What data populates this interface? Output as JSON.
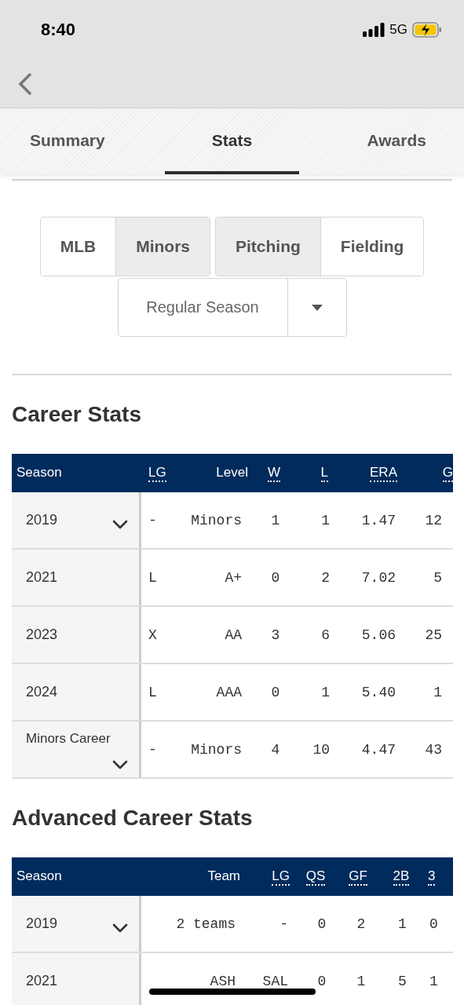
{
  "status_bar": {
    "time": "8:40",
    "network": "5G",
    "charging": true
  },
  "tabs": [
    {
      "label": "Summary",
      "selected": false
    },
    {
      "label": "Stats",
      "selected": true
    },
    {
      "label": "Awards",
      "selected": false
    }
  ],
  "segment_groups": [
    [
      {
        "label": "MLB",
        "selected": false
      },
      {
        "label": "Minors",
        "selected": true
      }
    ],
    [
      {
        "label": "Pitching",
        "selected": true
      },
      {
        "label": "Fielding",
        "selected": false
      }
    ]
  ],
  "season_type": {
    "value": "Regular Season"
  },
  "tables": [
    {
      "title": "Career Stats",
      "columns": [
        {
          "label": "Season",
          "abbr": false
        },
        {
          "label": "LG",
          "abbr": true
        },
        {
          "label": "Level",
          "abbr": false
        },
        {
          "label": "W",
          "abbr": true
        },
        {
          "label": "L",
          "abbr": true
        },
        {
          "label": "ERA",
          "abbr": true
        },
        {
          "label": "G",
          "abbr": true
        }
      ],
      "rows": [
        {
          "expandable": true,
          "cells": [
            "2019",
            "-",
            "Minors",
            "1",
            "1",
            "1.47",
            "12"
          ]
        },
        {
          "expandable": false,
          "cells": [
            "2021",
            "L",
            "A+",
            "0",
            "2",
            "7.02",
            "5"
          ]
        },
        {
          "expandable": false,
          "cells": [
            "2023",
            "X",
            "AA",
            "3",
            "6",
            "5.06",
            "25"
          ]
        },
        {
          "expandable": false,
          "cells": [
            "2024",
            "L",
            "AAA",
            "0",
            "1",
            "5.40",
            "1"
          ]
        },
        {
          "expandable": true,
          "cells": [
            "Minors Career",
            "-",
            "Minors",
            "4",
            "10",
            "4.47",
            "43"
          ]
        }
      ]
    },
    {
      "title": "Advanced Career Stats",
      "columns": [
        {
          "label": "Season",
          "abbr": false
        },
        {
          "label": "Team",
          "abbr": false
        },
        {
          "label": "LG",
          "abbr": true
        },
        {
          "label": "QS",
          "abbr": true
        },
        {
          "label": "GF",
          "abbr": true
        },
        {
          "label": "2B",
          "abbr": true
        },
        {
          "label": "3",
          "abbr": true
        }
      ],
      "rows": [
        {
          "expandable": true,
          "cells": [
            "2019",
            "2 teams",
            "-",
            "0",
            "2",
            "1",
            "0"
          ]
        },
        {
          "expandable": false,
          "cells": [
            "2021",
            "ASH",
            "SAL",
            "0",
            "1",
            "5",
            "1"
          ]
        }
      ]
    }
  ]
}
